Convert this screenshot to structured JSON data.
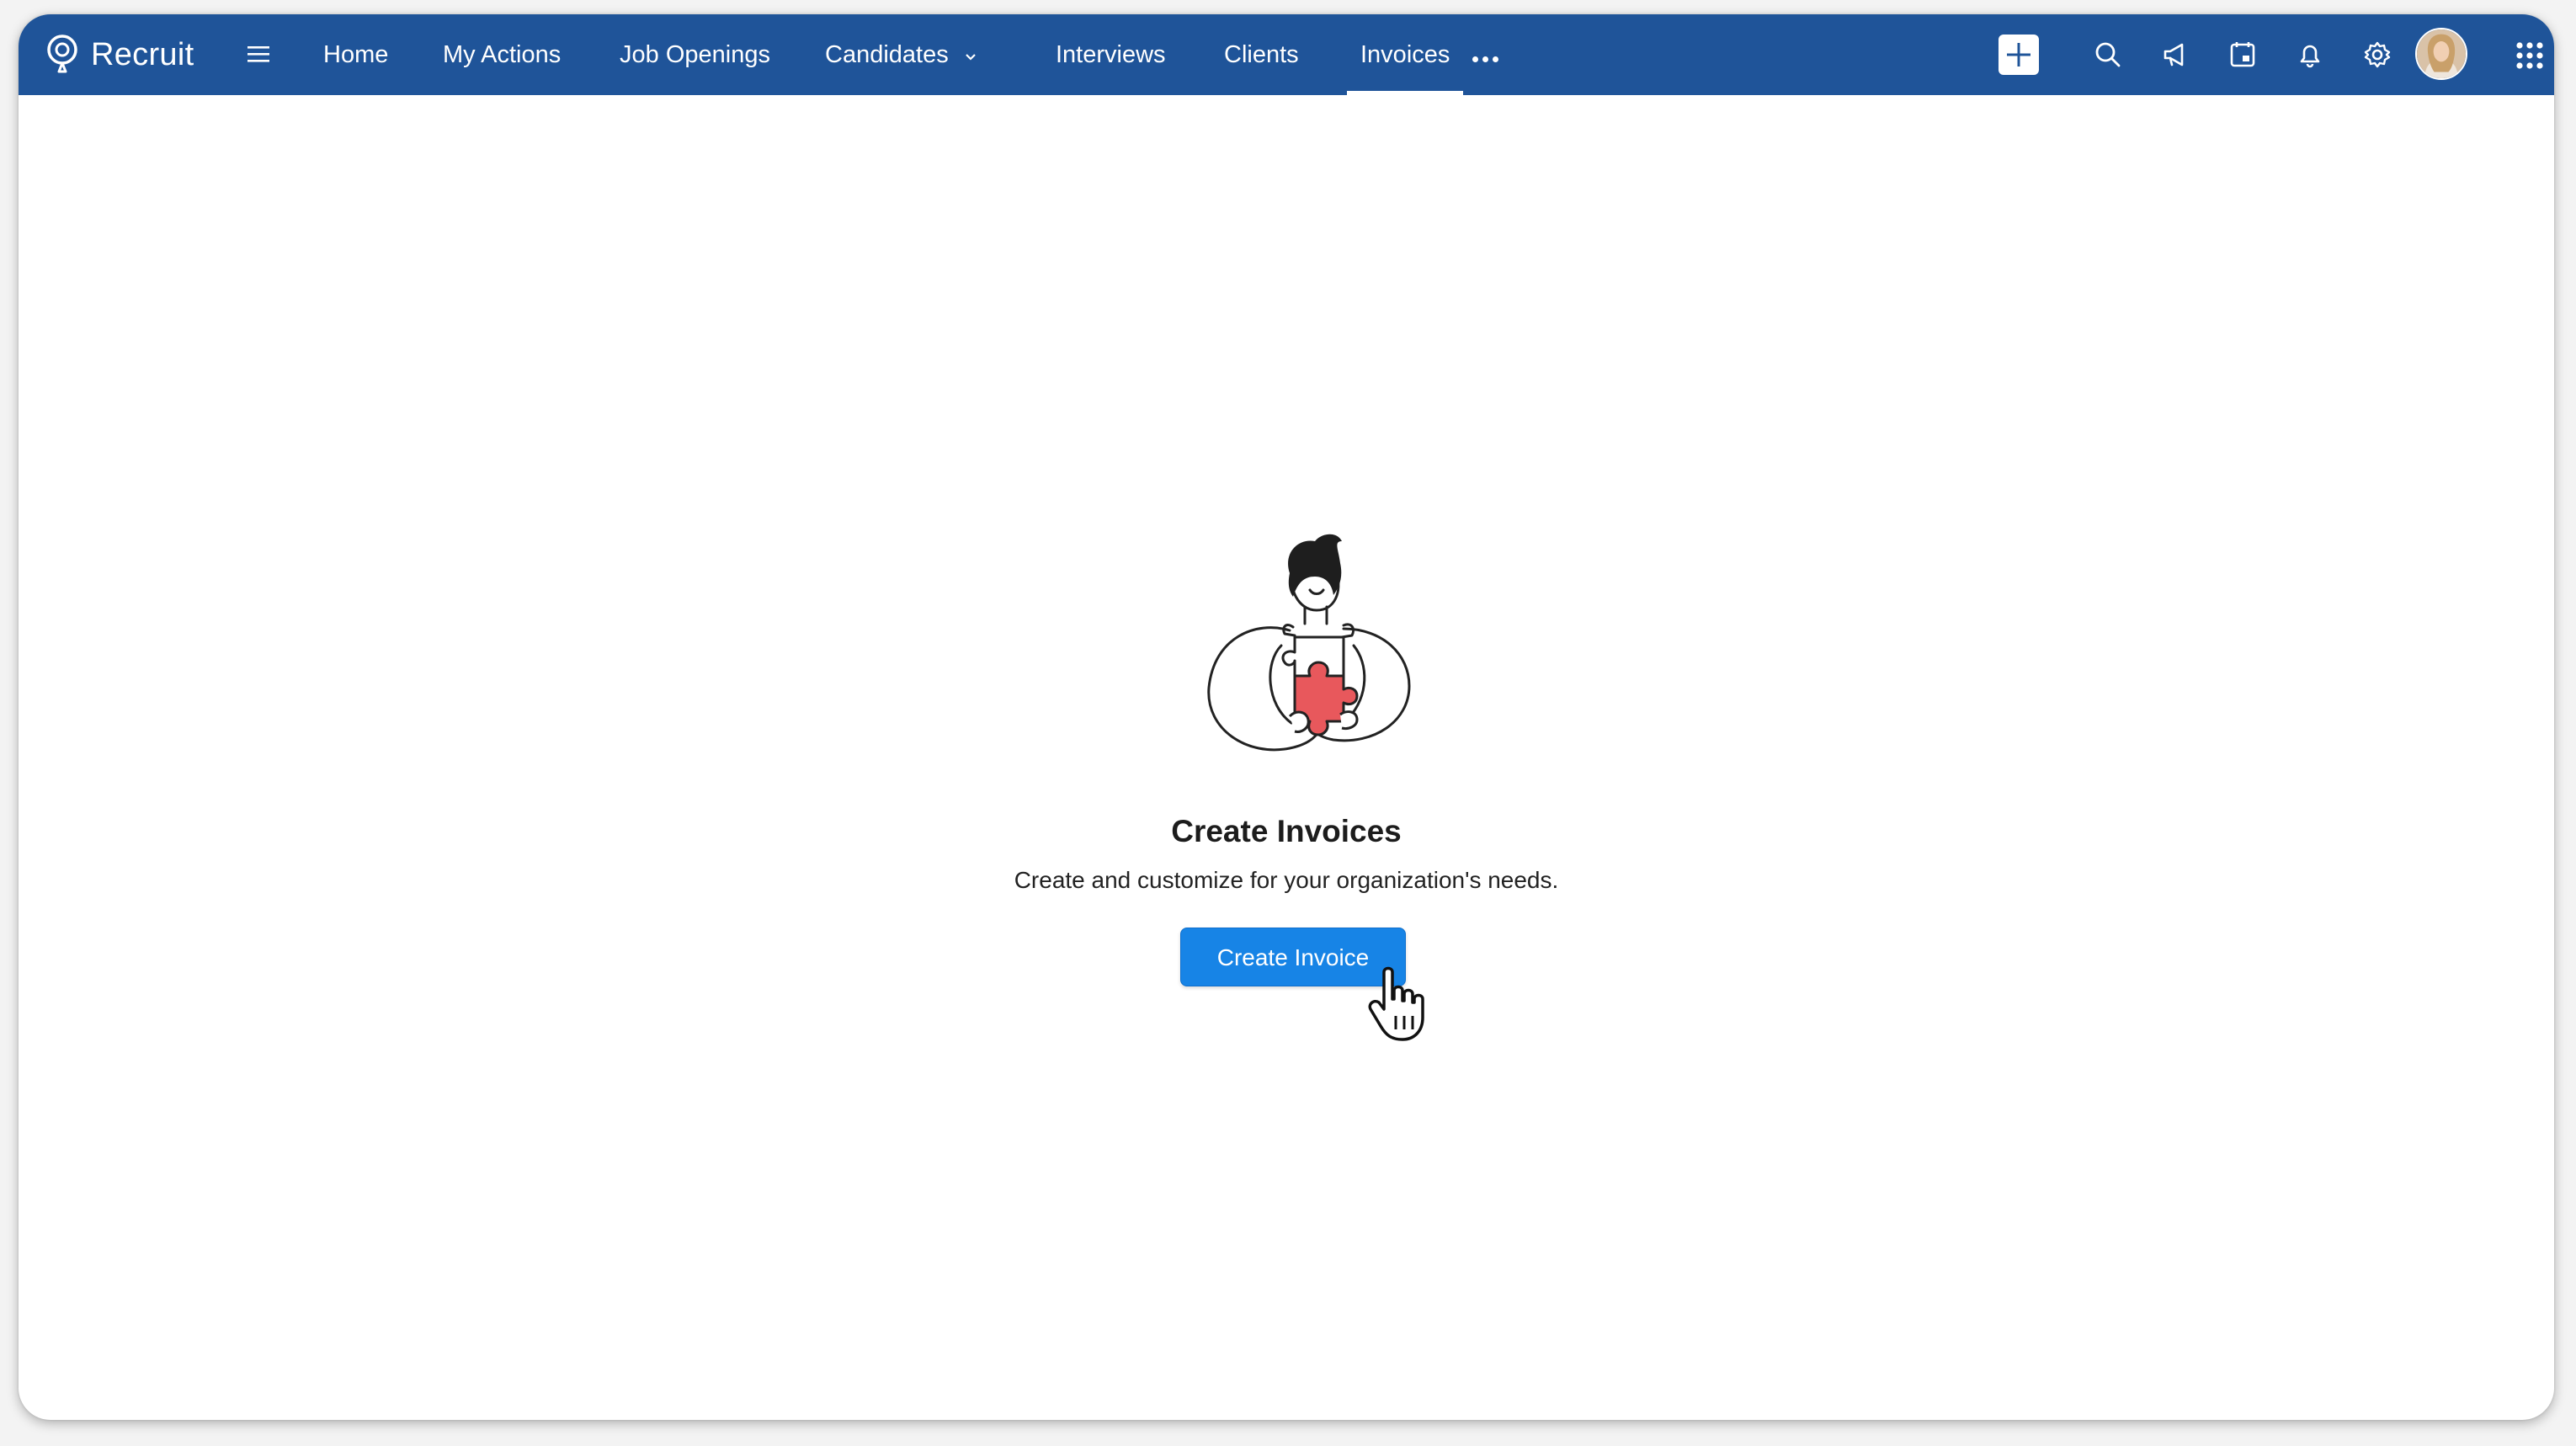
{
  "app": {
    "name": "Recruit"
  },
  "nav": {
    "items": [
      {
        "label": "Home"
      },
      {
        "label": "My Actions"
      },
      {
        "label": "Job Openings"
      },
      {
        "label": "Candidates"
      },
      {
        "label": "Interviews"
      },
      {
        "label": "Clients"
      },
      {
        "label": "Invoices",
        "active": true
      }
    ]
  },
  "toolbar": {
    "icons": [
      "plus-icon",
      "search-icon",
      "announcement-icon",
      "calendar-icon",
      "bell-icon",
      "gear-icon",
      "avatar",
      "apps-grid-icon"
    ]
  },
  "empty_state": {
    "title": "Create Invoices",
    "subtitle": "Create and customize for your organization's needs.",
    "button_label": "Create Invoice"
  },
  "colors": {
    "topbar": "#1f5499",
    "primary_button": "#1784e6",
    "puzzle_accent": "#e8585c"
  }
}
